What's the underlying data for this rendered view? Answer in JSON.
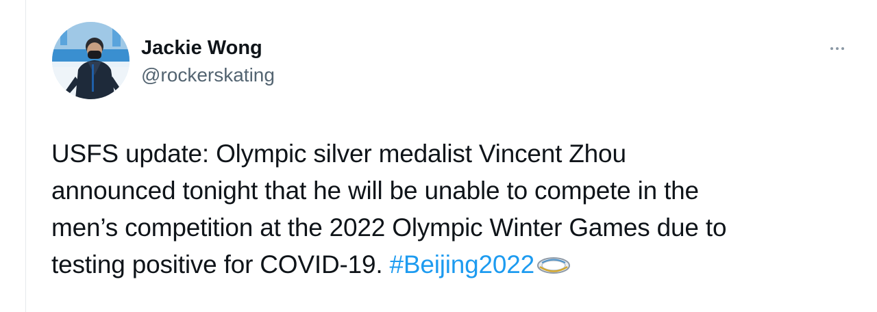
{
  "tweet": {
    "author": {
      "display_name": "Jackie Wong",
      "handle": "@rockerskating"
    },
    "text_lines": [
      "USFS update: Olympic silver medalist Vincent Zhou",
      "announced tonight that he will be unable to compete in the",
      "men’s competition at the 2022 Olympic Winter Games due to",
      "testing positive for COVID-19. "
    ],
    "hashtag": "#Beijing2022",
    "hashflag_icon": "olympic-ring-emoji-icon",
    "more_icon": "more-options-icon"
  },
  "colors": {
    "text": "#0f1419",
    "secondary": "#536471",
    "link": "#1d9bf0",
    "more_dots": "#8b98a5",
    "border": "#e6e9ec"
  }
}
